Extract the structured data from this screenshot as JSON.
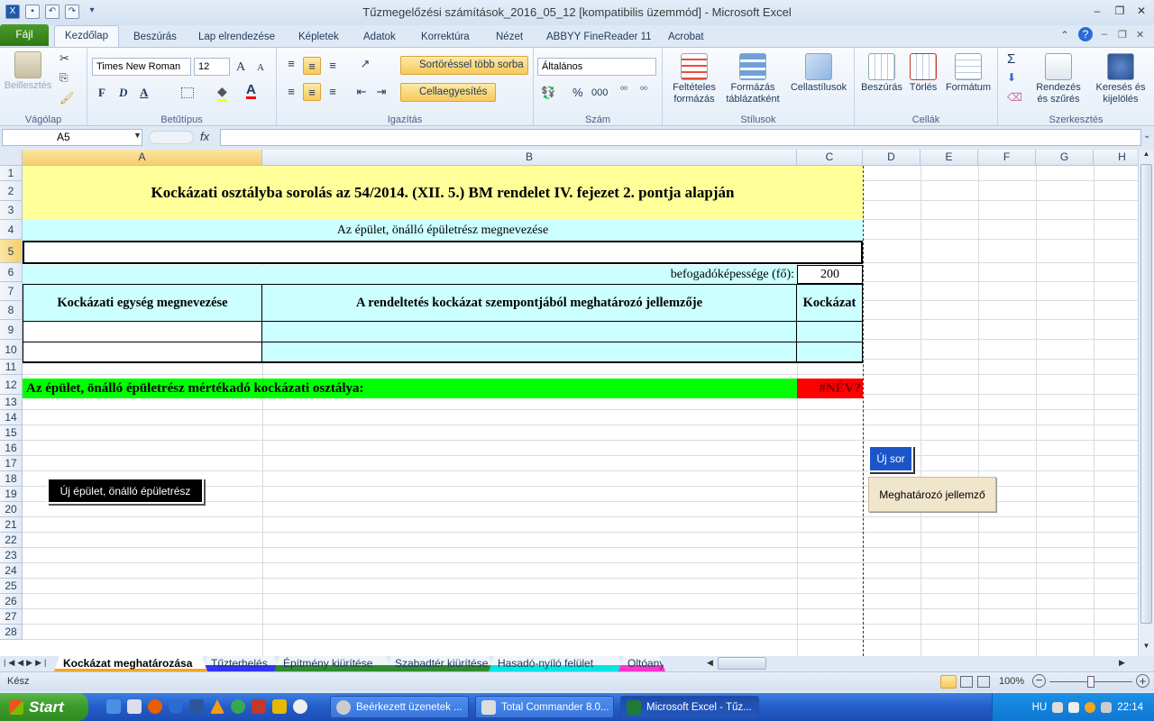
{
  "window": {
    "title": "Tűzmegelőzési számítások_2016_05_12  [kompatibilis üzemmód]  -  Microsoft Excel",
    "minimize": "–",
    "restore": "❐",
    "close": "✕"
  },
  "ribbon_tabs": [
    "Fájl",
    "Kezdőlap",
    "Beszúrás",
    "Lap elrendezése",
    "Képletek",
    "Adatok",
    "Korrektúra",
    "Nézet",
    "ABBYY FineReader 11",
    "Acrobat"
  ],
  "ribbon": {
    "clipboard": {
      "paste": "Beillesztés",
      "label": "Vágólap"
    },
    "font": {
      "name": "Times New Roman",
      "size": "12",
      "bold": "F",
      "italic": "D",
      "underline": "A",
      "color_a": "A",
      "label": "Betűtípus",
      "grow": "A",
      "shrink": "A"
    },
    "alignment": {
      "wrap": "Sortöréssel több sorba",
      "merge": "Cellaegyesítés",
      "label": "Igazítás"
    },
    "number": {
      "format": "Általános",
      "percent": "%",
      "thousands": "000",
      "label": "Szám"
    },
    "styles": {
      "conditional": "Feltételes formázás",
      "table": "Formázás táblázatként",
      "cell": "Cellastílusok",
      "label": "Stílusok"
    },
    "cells": {
      "insert": "Beszúrás",
      "delete": "Törlés",
      "format": "Formátum",
      "label": "Cellák"
    },
    "editing": {
      "sort": "Rendezés és szűrés",
      "find": "Keresés és kijelölés",
      "label": "Szerkesztés",
      "sigma": "Σ"
    }
  },
  "formula_bar": {
    "namebox": "A5",
    "fx": "fx",
    "value": ""
  },
  "columns": [
    "A",
    "B",
    "C",
    "D",
    "E",
    "F",
    "G",
    "H"
  ],
  "rows": [
    "1",
    "2",
    "3",
    "4",
    "5",
    "6",
    "7",
    "8",
    "9",
    "10",
    "11",
    "12",
    "13",
    "14",
    "15",
    "16",
    "17",
    "18",
    "19",
    "20",
    "21",
    "22",
    "23",
    "24",
    "25",
    "26",
    "27",
    "28"
  ],
  "sheet": {
    "title": "Kockázati osztályba sorolás az 54/2014. (XII. 5.) BM rendelet IV. fejezet 2. pontja alapján",
    "building_label": "Az épület, önálló épületrész megnevezése",
    "building_value": "",
    "capacity_label": "befogadóképessége (fő):",
    "capacity_value": "200",
    "hdr_unit": "Kockázati egység megnevezése",
    "hdr_char": "A rendeltetés kockázat szempontjából meghatározó jellemzője",
    "hdr_risk": "Kockázat",
    "result_label": "Az épület, önálló épületrész mértékadó kockázati osztálya:",
    "result_value": "#NÉV?"
  },
  "buttons": {
    "new_building": "Új épület, önálló épületrész",
    "new_row": "Új sor",
    "determining": "Meghatározó jellemző"
  },
  "sheet_tabs": [
    {
      "label": "Kockázat meghatározása",
      "color": "#ffffff",
      "active": true
    },
    {
      "label": "Tűzterhelés",
      "color": "#3333ff"
    },
    {
      "label": "Építmény kiürítése",
      "color": "#2e8b2e"
    },
    {
      "label": "Szabadtér kiürítése",
      "color": "#2e8b2e"
    },
    {
      "label": "Hasadó-nyíló felület",
      "color": "#00e5e5"
    },
    {
      "label": "Oltóany",
      "color": "#ff33cc"
    }
  ],
  "status": {
    "ready": "Kész",
    "zoom": "100%"
  },
  "taskbar": {
    "start": "Start",
    "tasks": [
      "Beérkezett üzenetek ...",
      "Total Commander 8.0...",
      "Microsoft Excel - Tűz..."
    ],
    "lang": "HU",
    "clock": "22:14"
  },
  "colors": {
    "yellow": "#ffff99",
    "cyan": "#ccffff",
    "green": "#00ff00",
    "red": "#ff0000",
    "accent": "#2b579a"
  }
}
